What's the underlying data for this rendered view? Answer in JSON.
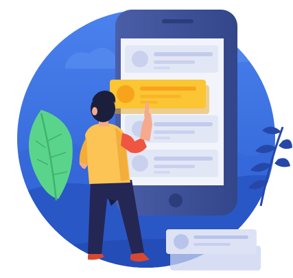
{
  "illustration": {
    "subject": "person-selecting-item-on-phone-list",
    "icons": [
      "phone-icon",
      "person-icon",
      "leaf-icon",
      "fern-icon",
      "list-card-icon",
      "avatar-circle-icon"
    ],
    "list_items_highlighted": 1,
    "list_items_total": 4
  },
  "colors": {
    "circle_background": "#3b6fe0",
    "circle_dark": "#2a56c4",
    "phone_body": "#3d5196",
    "phone_screen": "#f2f4fb",
    "card": "#dfe4f4",
    "card_line": "#c2cbea",
    "highlight_card": "#fbc534",
    "highlight_circle": "#f7a41c",
    "leaf_green": "#5bd48b",
    "shirt": "#fbc454",
    "sleeve": "#f05542",
    "pants": "#242654",
    "hair": "#1c1f3c",
    "skin": "#f6a98c"
  }
}
